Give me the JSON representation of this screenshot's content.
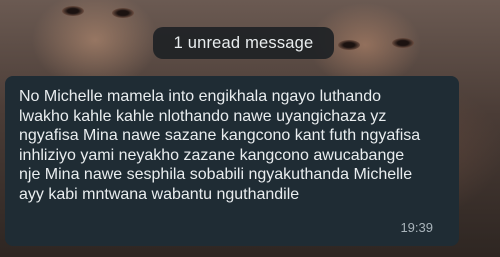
{
  "chat": {
    "unread_banner": "1 unread message",
    "message": {
      "text": "No Michelle mamela into engikhala ngayo luthando lwakho kahle kahle nlothando nawe uyangichaza yz ngyafisa Mina nawe sazane kangcono kant futh ngyafisa inhliziyo yami neyakho zazane kangcono awucabange nje Mina nawe sesphila sobabili ngyakuthanda Michelle ayy kabi mntwana wabantu nguthandile",
      "time": "19:39"
    }
  },
  "colors": {
    "bubble_background": "#1f2c34",
    "banner_background": "#1e2225",
    "text_primary": "#e9edef",
    "text_secondary": "#a8b3ba"
  }
}
